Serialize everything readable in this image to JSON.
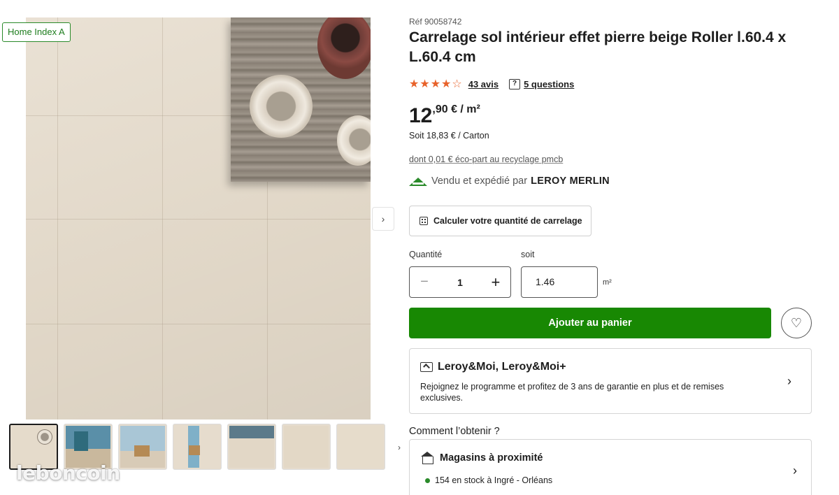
{
  "badge": "Home Index A",
  "gallery": {
    "next_label": "›",
    "thumbs_next_label": "›",
    "thumb_count": 7
  },
  "watermark": "leboncoin",
  "product": {
    "ref": "Réf 90058742",
    "title": "Carrelage sol intérieur effet pierre beige Roller l.60.4 x L.60.4 cm",
    "rating": {
      "stars": 4,
      "max": 5,
      "reviews_label": "43 avis",
      "questions_label": "5 questions"
    },
    "price": {
      "integer": "12",
      "decimal": ",90 € / m²"
    },
    "carton_price": "Soit 18,83 € / Carton",
    "eco_part": "dont 0,01 € éco-part au recyclage pmcb",
    "seller": {
      "prefix": "Vendu et expédié par",
      "name": "LEROY MERLIN"
    },
    "calc_button": "Calculer votre quantité de carrelage",
    "quantity": {
      "label": "Quantité",
      "value": "1",
      "minus": "−",
      "plus": "+"
    },
    "area": {
      "label": "soit",
      "value": "1.46",
      "unit": "m²"
    },
    "cart_button": "Ajouter au panier",
    "fav_icon": "♡"
  },
  "loyalty": {
    "title": "Leroy&Moi, Leroy&Moi+",
    "desc": "Rejoignez le programme et profitez de 3 ans de garantie en plus et de remises exclusives.",
    "chevron": "›"
  },
  "obtain": {
    "heading": "Comment l’obtenir ?",
    "store_title": "Magasins à proximité",
    "stock": "154 en stock à Ingré - Orléans",
    "chevron": "›"
  },
  "colors": {
    "accent_green": "#188803",
    "star_orange": "#e8622a",
    "tile_beige": "#e5dbcb"
  }
}
